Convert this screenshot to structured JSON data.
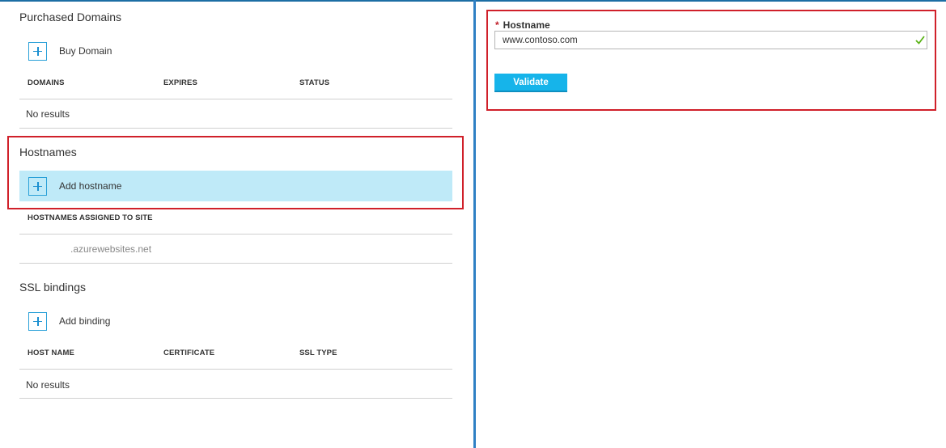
{
  "purchased_domains": {
    "title": "Purchased Domains",
    "add_label": "Buy Domain",
    "columns": [
      "DOMAINS",
      "EXPIRES",
      "STATUS"
    ],
    "empty_text": "No results"
  },
  "hostnames": {
    "title": "Hostnames",
    "add_label": "Add hostname",
    "column": "HOSTNAMES ASSIGNED TO SITE",
    "rows": [
      ".azurewebsites.net"
    ]
  },
  "ssl_bindings": {
    "title": "SSL bindings",
    "add_label": "Add binding",
    "columns": [
      "HOST NAME",
      "CERTIFICATE",
      "SSL TYPE"
    ],
    "empty_text": "No results"
  },
  "hostname_form": {
    "required_mark": "*",
    "label": "Hostname",
    "value": "www.contoso.com",
    "validate_label": "Validate"
  },
  "colors": {
    "accent": "#16b4ea",
    "highlight_row": "#bfeaf8",
    "callout_red": "#d0202a",
    "valid_check": "#5bb318"
  },
  "icons": [
    "plus-icon",
    "checkmark-icon"
  ]
}
